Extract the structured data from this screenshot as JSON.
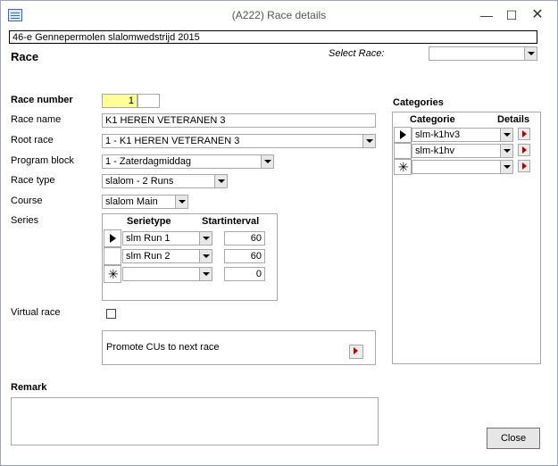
{
  "window": {
    "title": "(A222) Race details"
  },
  "header": {
    "event_name": "46-e Gennepermolen slalomwedstrijd 2015",
    "section_title": "Race",
    "select_race_label": "Select Race:",
    "select_race_value": ""
  },
  "race": {
    "race_number_label": "Race number",
    "race_number": "1",
    "race_name_label": "Race name",
    "race_name": "K1  HEREN VETERANEN 3",
    "root_race_label": "Root race",
    "root_race": "1  - K1  HEREN VETERANEN 3",
    "program_block_label": "Program block",
    "program_block": "1 - Zaterdagmiddag",
    "race_type_label": "Race type",
    "race_type": "slalom - 2 Runs",
    "course_label": "Course",
    "course": "slalom Main",
    "series_label": "Series",
    "virtual_race_label": "Virtual race"
  },
  "series": {
    "col_serietype": "Serietype",
    "col_startinterval": "Startinterval",
    "rows": [
      {
        "serietype": "slm Run 1",
        "startinterval": "60"
      },
      {
        "serietype": "slm Run 2",
        "startinterval": "60"
      },
      {
        "serietype": "",
        "startinterval": "0"
      }
    ]
  },
  "promote": {
    "label": "Promote CUs to next race"
  },
  "categories": {
    "title": "Categories",
    "col_categorie": "Categorie",
    "col_details": "Details",
    "rows": [
      {
        "categorie": "slm-k1hv3"
      },
      {
        "categorie": "slm-k1hv"
      },
      {
        "categorie": ""
      }
    ]
  },
  "remark": {
    "label": "Remark",
    "value": ""
  },
  "close_label": "Close",
  "icons": {
    "current_record": "record-selector-icon",
    "new_record": "new-record-icon"
  },
  "colors": {
    "highlight_field": "#ffff99",
    "nav_arrow": "#b00000"
  }
}
